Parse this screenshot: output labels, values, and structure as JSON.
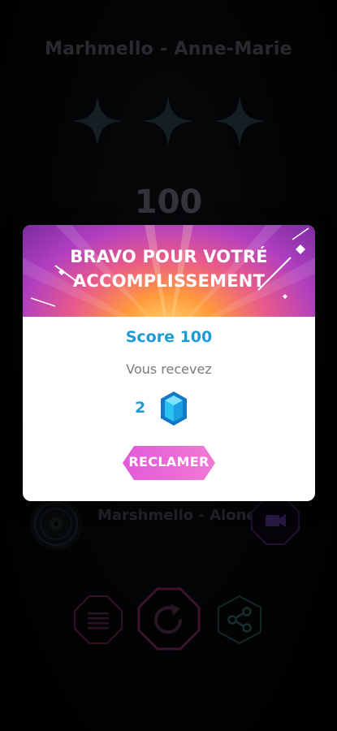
{
  "song": {
    "title": "Marhmello - Anne-Marie"
  },
  "result": {
    "stars_filled": 0,
    "stars_total": 3,
    "score": "100"
  },
  "next_track": {
    "name": "Marshmello - Alone",
    "disc_icon": "vinyl-disc-icon",
    "video_icon": "video-camera-icon"
  },
  "bottom_actions": {
    "menu_icon": "menu-lines-icon",
    "replay_icon": "replay-icon",
    "share_icon": "share-icon"
  },
  "modal": {
    "title_line1": "BRAVO POUR VOTRÉ",
    "title_line2": "ACCOMPLISSEMENT",
    "score_text": "Score 100",
    "receive_text": "Vous recevez",
    "reward_count": "2",
    "reward_icon": "blue-gem-icon",
    "claim_label": "RECLAMER"
  },
  "colors": {
    "accent_blue": "#1e9bd7",
    "claim_pink": "#e05fd9",
    "menu_ring": "#7b2a5c",
    "replay_ring": "#8a2b5e",
    "share_ring": "#2e5a56"
  }
}
